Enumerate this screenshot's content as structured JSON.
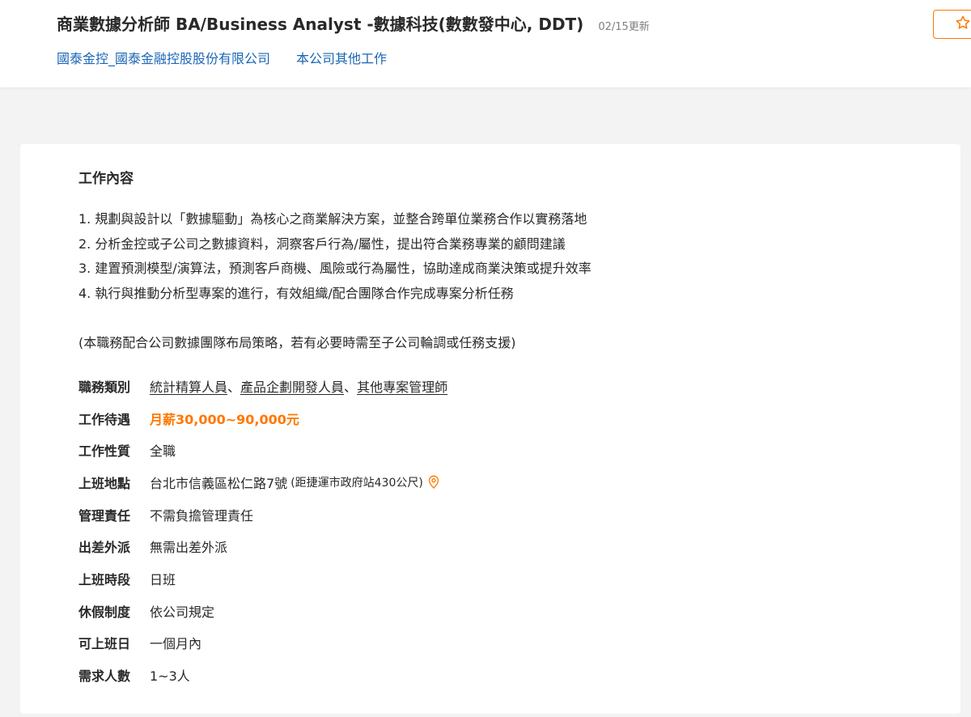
{
  "header": {
    "job_title": "商業數據分析師 BA/Business Analyst -數據科技(數數發中心, DDT)",
    "update_date": "02/15更新",
    "company_name": "國泰金控_國泰金融控股股份有限公司",
    "other_jobs_link": "本公司其他工作",
    "save_icon": "star-outline-icon"
  },
  "job_content": {
    "title": "工作內容",
    "lines": [
      "1. 規劃與設計以「數據驅動」為核心之商業解決方案，並整合跨單位業務合作以實務落地",
      "2. 分析金控或子公司之數據資料，洞察客戶行為/屬性，提出符合業務專業的顧問建議",
      "3. 建置預測模型/演算法，預測客戶商機、風險或行為屬性，協助達成商業決策或提升效率",
      "4. 執行與推動分析型專案的進行，有效組織/配合團隊合作完成專案分析任務"
    ],
    "note": "(本職務配合公司數據團隊布局策略，若有必要時需至子公司輪調或任務支援)"
  },
  "details": {
    "category_label": "職務類別",
    "categories": [
      "統計精算人員",
      "產品企劃開發人員",
      "其他專案管理師"
    ],
    "category_separator": "、",
    "salary_label": "工作待遇",
    "salary_value": "月薪30,000~90,000元",
    "job_type_label": "工作性質",
    "job_type_value": "全職",
    "location_label": "上班地點",
    "location_value": "台北市信義區松仁路7號",
    "location_distance": "(距捷運市政府站430公尺)",
    "management_label": "管理責任",
    "management_value": "不需負擔管理責任",
    "travel_label": "出差外派",
    "travel_value": "無需出差外派",
    "shift_label": "上班時段",
    "shift_value": "日班",
    "leave_label": "休假制度",
    "leave_value": "依公司規定",
    "start_label": "可上班日",
    "start_value": "一個月內",
    "headcount_label": "需求人數",
    "headcount_value": "1~3人"
  },
  "colors": {
    "accent": "#ff7800",
    "link": "#1a65b5",
    "text": "#292929",
    "muted": "#7e7e7e",
    "page_bg": "#f3f3f3"
  }
}
